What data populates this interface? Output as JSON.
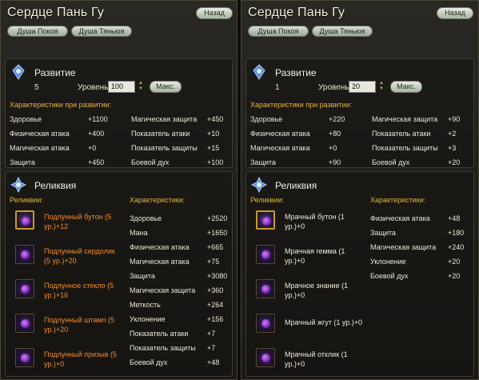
{
  "left": {
    "title": "Сердце Пань Гу",
    "back": "Назад",
    "tabs": [
      "Душа Покоя",
      "Душа Тяньюя"
    ],
    "dev": {
      "title": "Развитие",
      "level_num": "5",
      "level_label": "Уровень:",
      "level_value": "100",
      "max": "Макс.",
      "stats_head": "Характеристики при развитии:",
      "stats": [
        {
          "name": "Здоровье",
          "value": "+1100"
        },
        {
          "name": "Физическая атака",
          "value": "+400"
        },
        {
          "name": "Магическая атака",
          "value": "+0"
        },
        {
          "name": "Защита",
          "value": "+450"
        },
        {
          "name": "Магическая защита",
          "value": "+450"
        },
        {
          "name": "Показатель атаки",
          "value": "+10"
        },
        {
          "name": "Показатель защиты",
          "value": "+15"
        },
        {
          "name": "Боевой дух",
          "value": "+100"
        }
      ]
    },
    "rel": {
      "title": "Реликвия",
      "relics_head": "Реликвии:",
      "chars_head": "Характеристики:",
      "relics": [
        "Подлунный бутон (5 ур.)+12",
        "Подлунный сердолик (5 ур.)+20",
        "Подлунное стекло (5 ур.)+16",
        "Подлунный штамп (5 ур.)+20",
        "Подлунный призыв (5 ур.)+0"
      ],
      "stats": [
        {
          "name": "Здоровье",
          "value": "+2520"
        },
        {
          "name": "Мана",
          "value": "+1650"
        },
        {
          "name": "Физическая атака",
          "value": "+665"
        },
        {
          "name": "Магическая атака",
          "value": "+75"
        },
        {
          "name": "Защита",
          "value": "+3080"
        },
        {
          "name": "Магическая защита",
          "value": "+360"
        },
        {
          "name": "Меткость",
          "value": "+264"
        },
        {
          "name": "Уклонение",
          "value": "+156"
        },
        {
          "name": "Показатель атаки",
          "value": "+7"
        },
        {
          "name": "Показатель защиты",
          "value": "+7"
        },
        {
          "name": "Боевой дух",
          "value": "+48"
        }
      ]
    }
  },
  "right": {
    "title": "Сердце Пань Гу",
    "back": "Назад",
    "tabs": [
      "Душа Покоя",
      "Душа Тяньюя"
    ],
    "dev": {
      "title": "Развитие",
      "level_num": "1",
      "level_label": "Уровень:",
      "level_value": "20",
      "max": "Макс.",
      "stats_head": "Характеристики при развитии:",
      "stats": [
        {
          "name": "Здоровье",
          "value": "+220"
        },
        {
          "name": "Физическая атака",
          "value": "+80"
        },
        {
          "name": "Магическая атака",
          "value": "+0"
        },
        {
          "name": "Защита",
          "value": "+90"
        },
        {
          "name": "Магическая защита",
          "value": "+90"
        },
        {
          "name": "Показатель атаки",
          "value": "+2"
        },
        {
          "name": "Показатель защиты",
          "value": "+3"
        },
        {
          "name": "Боевой дух",
          "value": "+20"
        }
      ]
    },
    "rel": {
      "title": "Реликвия",
      "relics_head": "Реликвии:",
      "chars_head": "Характеристики:",
      "relics": [
        "Мрачный бутон (1 ур.)+0",
        "Мрачная гемма (1 ур.)+0",
        "Мрачное знание (1 ур.)+0",
        "Мрачный жгут (1 ур.)+0",
        "Мрачный отклик (1 ур.)+0"
      ],
      "stats": [
        {
          "name": "Физическая атака",
          "value": "+48"
        },
        {
          "name": "Защита",
          "value": "+180"
        },
        {
          "name": "Магическая защита",
          "value": "+240"
        },
        {
          "name": "Уклонение",
          "value": "+20"
        },
        {
          "name": "Боевой дух",
          "value": "+20"
        }
      ]
    }
  }
}
